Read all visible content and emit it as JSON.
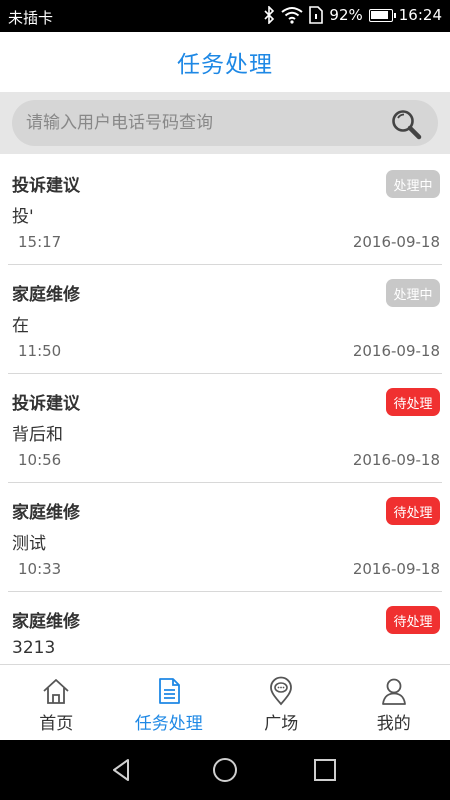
{
  "status_bar": {
    "carrier": "未插卡",
    "battery": "92%",
    "battery_level": 0.92,
    "time": "16:24"
  },
  "header": {
    "title": "任务处理"
  },
  "search": {
    "placeholder": "请输入用户电话号码查询"
  },
  "tasks": [
    {
      "type": "投诉建议",
      "description": "投'",
      "time": "15:17",
      "date": "2016-09-18",
      "status": "处理中",
      "status_color": "#c8c8c8"
    },
    {
      "type": "家庭维修",
      "description": "在",
      "time": "11:50",
      "date": "2016-09-18",
      "status": "处理中",
      "status_color": "#c8c8c8"
    },
    {
      "type": "投诉建议",
      "description": "背后和",
      "time": "10:56",
      "date": "2016-09-18",
      "status": "待处理",
      "status_color": "#f03030"
    },
    {
      "type": "家庭维修",
      "description": "测试",
      "time": "10:33",
      "date": "2016-09-18",
      "status": "待处理",
      "status_color": "#f03030"
    },
    {
      "type": "家庭维修",
      "description": "3213",
      "time": "",
      "date": "",
      "status": "待处理",
      "status_color": "#f03030"
    }
  ],
  "bottom_nav": {
    "items": [
      {
        "label": "首页",
        "icon": "home-icon"
      },
      {
        "label": "任务处理",
        "icon": "document-icon",
        "active": true
      },
      {
        "label": "广场",
        "icon": "location-chat-icon"
      },
      {
        "label": "我的",
        "icon": "person-icon"
      }
    ]
  },
  "colors": {
    "accent": "#1e88e5",
    "pending": "#f03030",
    "processing": "#c8c8c8"
  }
}
